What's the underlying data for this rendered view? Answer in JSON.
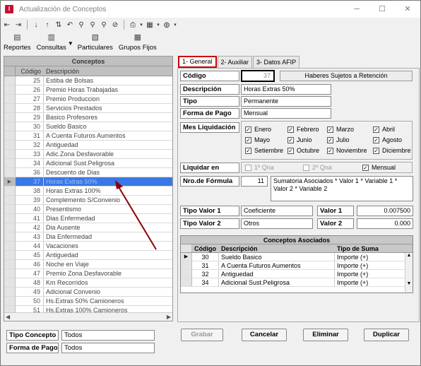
{
  "window": {
    "title": "Actualización de Conceptos",
    "app_icon": "I"
  },
  "toolbar_big": [
    {
      "label": "Reportes",
      "icon": "reports-icon",
      "glyph": "▤"
    },
    {
      "label": "Consultas",
      "icon": "queries-icon",
      "glyph": "▥"
    },
    {
      "label": "Particulares",
      "icon": "particulares-icon",
      "glyph": "▧"
    },
    {
      "label": "Grupos Fijos",
      "icon": "grupos-fijos-icon",
      "glyph": "▦"
    }
  ],
  "left_panel": {
    "header": "Conceptos",
    "col_code": "Código",
    "col_desc": "Descripción",
    "rows": [
      {
        "code": "25",
        "desc": "Estiba de Bolsas"
      },
      {
        "code": "26",
        "desc": "Premio Horas Trabajadas"
      },
      {
        "code": "27",
        "desc": "Premio Produccion"
      },
      {
        "code": "28",
        "desc": "Servicios Prestados"
      },
      {
        "code": "29",
        "desc": "Basico Profesores"
      },
      {
        "code": "30",
        "desc": "Sueldo Basico"
      },
      {
        "code": "31",
        "desc": "A Cuenta Futuros Aumentos"
      },
      {
        "code": "32",
        "desc": "Antiguedad"
      },
      {
        "code": "33",
        "desc": "Adic.Zona Desfavorable"
      },
      {
        "code": "34",
        "desc": "Adicional Sust.Peligrosa"
      },
      {
        "code": "36",
        "desc": "Descuento de Dias"
      },
      {
        "code": "37",
        "desc": "Horas Extras 50%"
      },
      {
        "code": "38",
        "desc": "Horas Extras 100%"
      },
      {
        "code": "39",
        "desc": "Complemento S/Convenio"
      },
      {
        "code": "40",
        "desc": "Presentismo"
      },
      {
        "code": "41",
        "desc": "Dias Enfermedad"
      },
      {
        "code": "42",
        "desc": "Dia Ausente"
      },
      {
        "code": "43",
        "desc": "Dia Enfermedad"
      },
      {
        "code": "44",
        "desc": "Vacaciones"
      },
      {
        "code": "45",
        "desc": "Antiguedad"
      },
      {
        "code": "46",
        "desc": "Noche en Viaje"
      },
      {
        "code": "47",
        "desc": "Premio Zona Desfavorable"
      },
      {
        "code": "48",
        "desc": "Km Recorridos"
      },
      {
        "code": "49",
        "desc": "Adicional Convenio"
      },
      {
        "code": "50",
        "desc": "Hs.Extras 50% Camioneros"
      },
      {
        "code": "51",
        "desc": "Hs.Extras 100% Camioneros"
      }
    ],
    "selected_code": "37"
  },
  "filters": {
    "tipo_concepto_label": "Tipo Concepto",
    "tipo_concepto_value": "Todos",
    "forma_pago_label": "Forma de Pago",
    "forma_pago_value": "Todos"
  },
  "tabs": [
    "1- General",
    "2- Auxiliar",
    "3- Datos AFIP"
  ],
  "form": {
    "codigo_label": "Código",
    "codigo_value": "37",
    "haberes_button": "Haberes Sujetos a Retención",
    "descripcion_label": "Descripción",
    "descripcion_value": "Horas Extras 50%",
    "tipo_label": "Tipo",
    "tipo_value": "Permanente",
    "forma_pago_label": "Forma de Pago",
    "forma_pago_value": "Mensual",
    "mes_liq_label": "Mes Liquidación",
    "months": [
      "Enero",
      "Febrero",
      "Marzo",
      "Abril",
      "Mayo",
      "Junio",
      "Julio",
      "Agosto",
      "Setiembre",
      "Octubre",
      "Noviembre",
      "Diciembre"
    ],
    "liquidar_label": "Liquidar en",
    "liquidar_opts": [
      "1º Qna",
      "2º Qna",
      "Mensual"
    ],
    "nro_formula_label": "Nro.de Fórmula",
    "nro_formula_value": "11",
    "formula_text": "Sumatoria Asociados * Valor 1 * Variable 1 * Valor 2 * Variable 2",
    "tipo_valor1_label": "Tipo Valor 1",
    "tipo_valor1_value": "Coeficiente",
    "valor1_label": "Valor 1",
    "valor1_value": "0.007500",
    "tipo_valor2_label": "Tipo Valor 2",
    "tipo_valor2_value": "Otros",
    "valor2_label": "Valor 2",
    "valor2_value": "0.000"
  },
  "asociados": {
    "title": "Conceptos Asociados",
    "col_code": "Código",
    "col_desc": "Descripción",
    "col_tipo": "Tipo de Suma",
    "rows": [
      {
        "code": "30",
        "desc": "Sueldo Basico",
        "tipo": "Importe (+)"
      },
      {
        "code": "31",
        "desc": "A Cuenta Futuros Aumentos",
        "tipo": "Importe (+)"
      },
      {
        "code": "32",
        "desc": "Antiguedad",
        "tipo": "Importe (+)"
      },
      {
        "code": "34",
        "desc": "Adicional Sust.Peligrosa",
        "tipo": "Importe (+)"
      }
    ]
  },
  "actions": {
    "grabar": "Grabar",
    "cancelar": "Cancelar",
    "eliminar": "Eliminar",
    "duplicar": "Duplicar"
  }
}
